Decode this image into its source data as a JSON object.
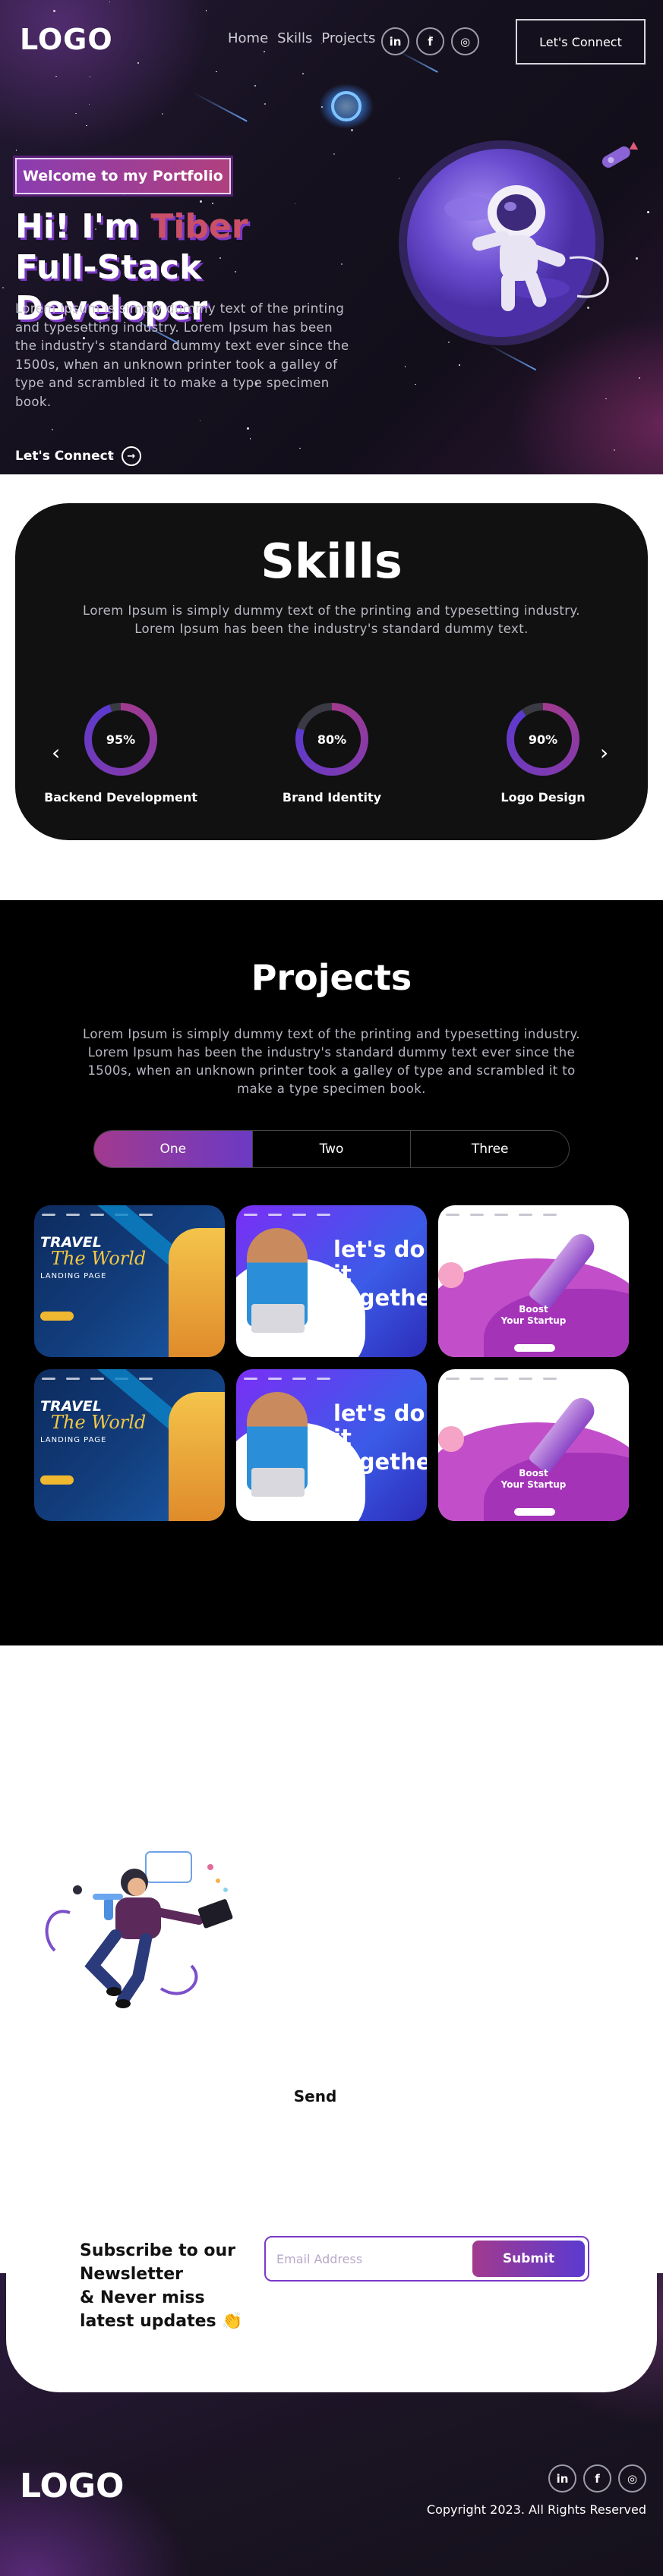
{
  "header": {
    "logo": "LOGO",
    "nav": [
      {
        "label": "Home"
      },
      {
        "label": "Skills"
      },
      {
        "label": "Projects"
      }
    ],
    "social": [
      {
        "icon": "linkedin-icon",
        "glyph": "in"
      },
      {
        "icon": "facebook-icon",
        "glyph": "f"
      },
      {
        "icon": "instagram-icon",
        "glyph": "◎"
      }
    ],
    "cta": "Let's Connect"
  },
  "hero": {
    "badge": "Welcome to my Portfolio",
    "title_pre": "Hi! I'm ",
    "title_name": "Tiber",
    "title_post": " Full-Stack Developer",
    "text": "Lorem Ipsum is simply dummy text of the printing and typesetting industry. Lorem Ipsum has been the industry's standard dummy text ever since the 1500s, when an unknown printer took a galley of type and scrambled it to make a type specimen book.",
    "link": "Let's Connect",
    "link_icon": "→"
  },
  "skills": {
    "title": "Skills",
    "text": "Lorem Ipsum is simply dummy text of the printing and typesetting industry. Lorem Ipsum has been the industry's standard dummy text.",
    "prev_icon": "‹",
    "next_icon": "›",
    "items": [
      {
        "percent": "95%",
        "value": 0.95,
        "label": "Backend Development"
      },
      {
        "percent": "80%",
        "value": 0.8,
        "label": "Brand Identity"
      },
      {
        "percent": "90%",
        "value": 0.9,
        "label": "Logo Design"
      }
    ]
  },
  "projects": {
    "title": "Projects",
    "text": "Lorem Ipsum is simply dummy text of the printing and typesetting industry. Lorem Ipsum has been the industry's standard dummy text ever since the 1500s, when an unknown printer took a galley of type and scrambled it to make a type specimen book.",
    "tabs": [
      {
        "label": "One",
        "active": true
      },
      {
        "label": "Two",
        "active": false
      },
      {
        "label": "Three",
        "active": false
      }
    ],
    "cards": {
      "travel": {
        "line1": "TRAVEL",
        "line2": "The World",
        "line3": "LANDING PAGE"
      },
      "doit": {
        "line1": "let's do it",
        "line2": "together"
      },
      "boost": {
        "line1": "Boost",
        "line2": "Your Startup"
      }
    }
  },
  "contact": {
    "send": "Send"
  },
  "newsletter": {
    "title_1": "Subscribe to our Newsletter",
    "title_2": "& Never miss latest updates",
    "emoji": "👏",
    "placeholder": "Email Address",
    "submit": "Submit"
  },
  "footer": {
    "logo": "LOGO",
    "copyright": "Copyright 2023. All Rights Reserved"
  },
  "colors": {
    "accent_pink": "#c95068",
    "accent_purple": "#7b38c4",
    "ring_gradient_start": "#a23a8e",
    "ring_gradient_end": "#5b3ad0"
  }
}
